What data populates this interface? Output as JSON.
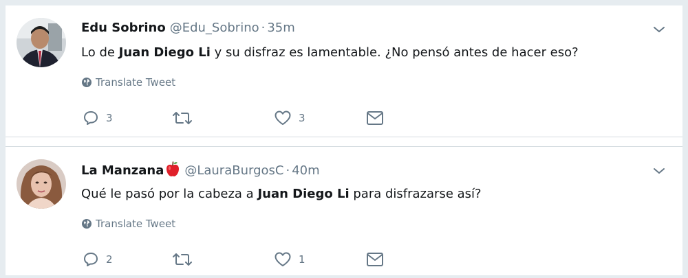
{
  "tweets": [
    {
      "name": "Edu Sobrino",
      "handle": "@Edu_Sobrino",
      "dot": "·",
      "time": "35m",
      "text_parts": [
        "Lo de ",
        "Juan Diego Li",
        " y su disfraz es lamentable. ¿No pensó antes de hacer eso?"
      ],
      "translate_label": "Translate Tweet",
      "reply_count": "3",
      "like_count": "3",
      "icons": [
        "avatar-photo",
        "chevron-down-icon",
        "globe-icon",
        "reply-icon",
        "retweet-icon",
        "heart-icon",
        "envelope-icon"
      ]
    },
    {
      "name": "La Manzana",
      "handle": "@LauraBurgosC",
      "dot": "·",
      "time": "40m",
      "text_parts": [
        "Qué le pasó por la cabeza a ",
        "Juan Diego Li",
        " para disfrazarse así?"
      ],
      "translate_label": "Translate Tweet",
      "reply_count": "2",
      "like_count": "1",
      "icons": [
        "avatar-photo",
        "apple-emoji-icon",
        "chevron-down-icon",
        "globe-icon",
        "reply-icon",
        "retweet-icon",
        "heart-icon",
        "envelope-icon"
      ]
    }
  ],
  "colors": {
    "background": "#e6ecf0",
    "text_primary": "#14171a",
    "text_secondary": "#657786",
    "apple_red": "#e0202a"
  }
}
